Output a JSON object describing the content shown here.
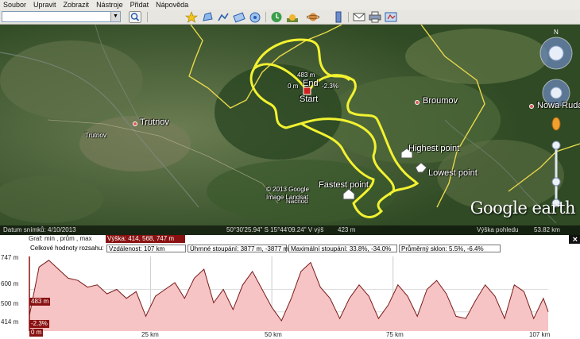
{
  "menu": [
    "Soubor",
    "Upravit",
    "Zobrazit",
    "Nástroje",
    "Přidat",
    "Nápověda"
  ],
  "map": {
    "places": [
      {
        "name": "Trutnov",
        "kind": "city"
      },
      {
        "name": "Trutnov",
        "kind": "small"
      },
      {
        "name": "Broumov",
        "kind": "city"
      },
      {
        "name": "Nowa Ruda",
        "kind": "city"
      },
      {
        "name": "Náchod",
        "kind": "small"
      }
    ],
    "track_labels": {
      "elev_top": "483 m",
      "elev_left": "0 m",
      "grade": "-2.3%",
      "end": "End",
      "start": "Start",
      "highest": "Highest point",
      "lowest": "Lowest point",
      "fastest": "Fastest point"
    },
    "copyright": "© 2013 Google",
    "image_credit": "Image Landsat",
    "logo": "Google earth",
    "status": {
      "date": "Datum snímků: 4/10/2013",
      "coords": "50°30'25.94\" S 15°44'09.24\" V výš",
      "alt": "423 m",
      "view_label": "Výška pohledu",
      "view_value": "53.82 km"
    },
    "track_color": "#f2f230"
  },
  "elevation": {
    "graph_label": "Graf: min , prům , max",
    "height_label": "Výška: 414, 568, 747 m",
    "totals_label": "Celkové hodnoty rozsahu:",
    "distance": "Vzdálenost: 107 km",
    "climb": "Úhrnné stoupání: 3877 m, -3877 m",
    "max_climb": "Maximální stoupání: 33.8%, -34.0%",
    "avg_grade": "Průměrný sklon: 5.5%, -6.4%",
    "y_ticks": [
      "747 m",
      "600 m",
      "500 m",
      "414 m"
    ],
    "x_ticks": [
      "0 m",
      "25 km",
      "50 km",
      "75 km",
      "107 km"
    ],
    "marker_elev": "483 m",
    "marker_grade": "-2.3%",
    "close": "×"
  },
  "chart_data": {
    "type": "area",
    "xlabel": "",
    "ylabel": "",
    "xlim": [
      0,
      107
    ],
    "ylim": [
      414,
      747
    ],
    "x": [
      0,
      2,
      4,
      6,
      8,
      10,
      12,
      14,
      16,
      18,
      20,
      22,
      24,
      26,
      28,
      30,
      32,
      34,
      36,
      38,
      40,
      42,
      44,
      46,
      48,
      50,
      52,
      54,
      56,
      58,
      60,
      62,
      64,
      66,
      68,
      70,
      72,
      74,
      76,
      78,
      80,
      82,
      84,
      86,
      88,
      90,
      92,
      94,
      96,
      98,
      100,
      102,
      104,
      106,
      107
    ],
    "values": [
      483,
      700,
      730,
      690,
      650,
      640,
      610,
      620,
      580,
      600,
      560,
      590,
      480,
      570,
      600,
      630,
      560,
      650,
      690,
      540,
      600,
      510,
      620,
      680,
      600,
      520,
      460,
      560,
      680,
      720,
      610,
      560,
      470,
      560,
      620,
      570,
      470,
      530,
      620,
      570,
      480,
      600,
      640,
      580,
      480,
      470,
      550,
      620,
      570,
      470,
      620,
      590,
      470,
      560,
      500
    ],
    "colors": {
      "fill": "#f6c4c4",
      "line": "#7a1a1a"
    }
  }
}
